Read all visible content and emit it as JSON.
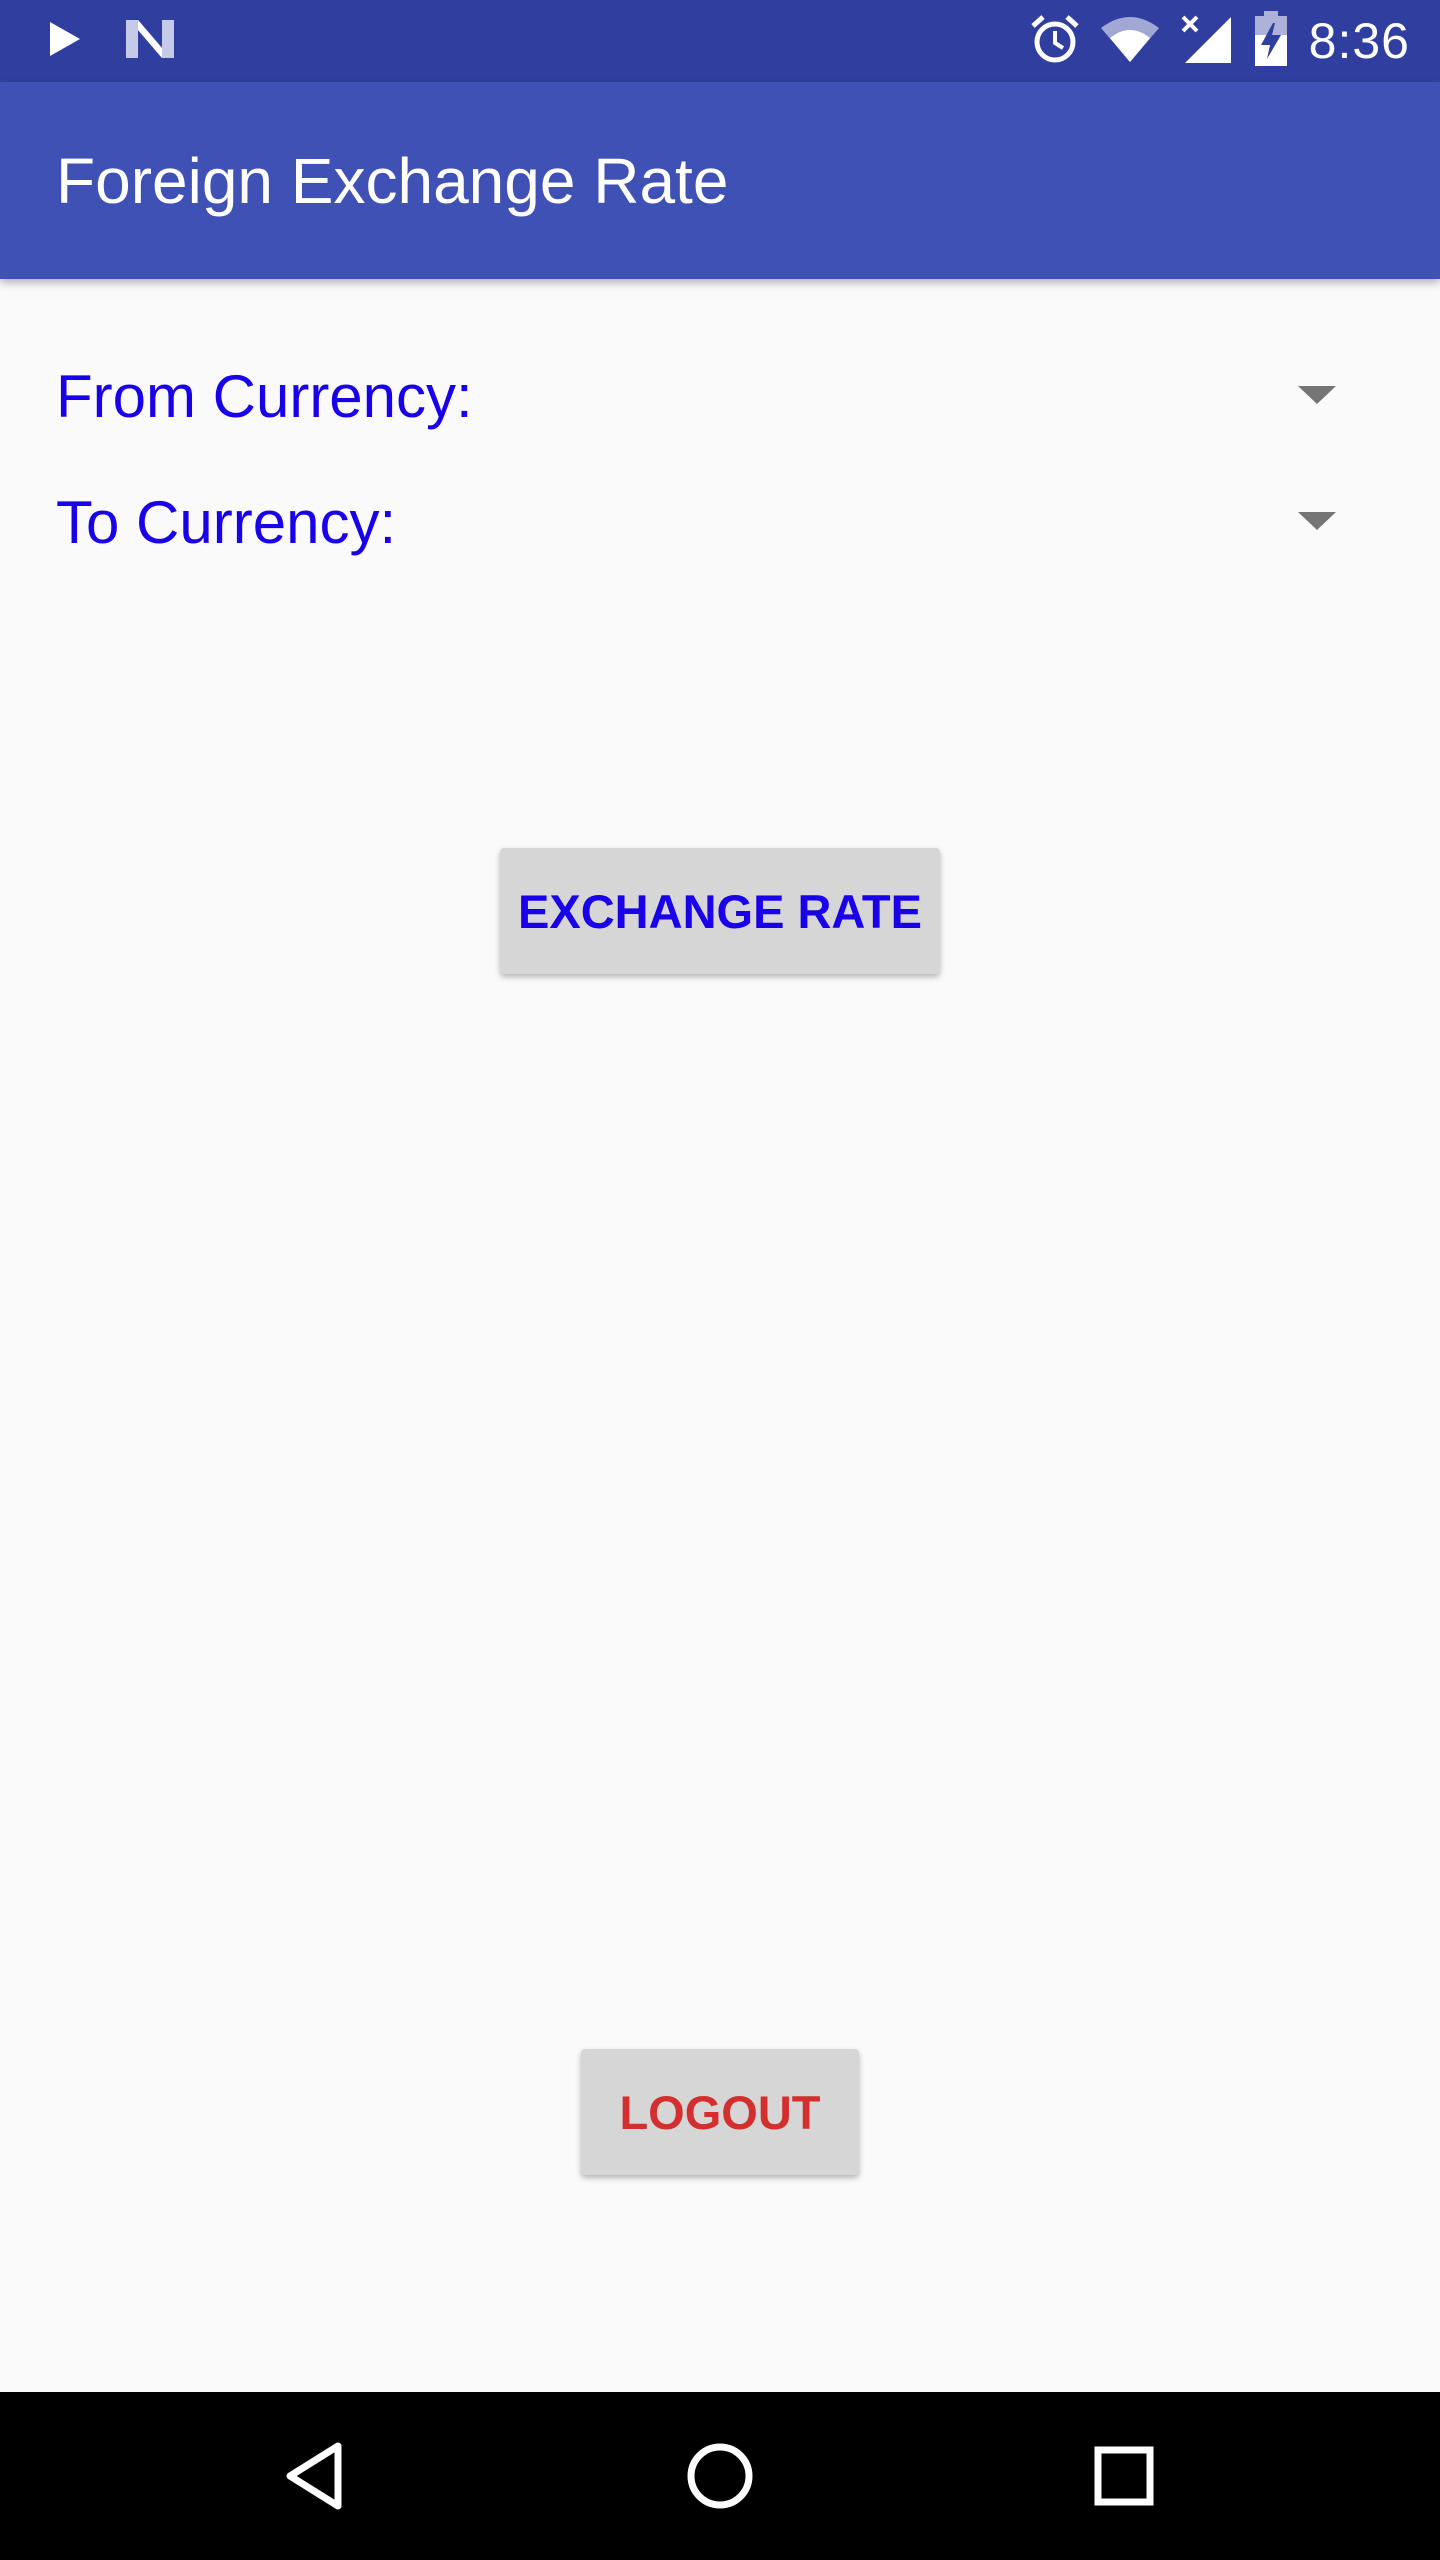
{
  "status_bar": {
    "time": "8:36",
    "icons": [
      "play-icon",
      "n-notification-icon",
      "alarm-icon",
      "wifi-icon",
      "signal-icon",
      "battery-charging-icon"
    ]
  },
  "app_bar": {
    "title": "Foreign Exchange Rate"
  },
  "form": {
    "from_label": "From Currency:",
    "to_label": "To Currency:"
  },
  "buttons": {
    "exchange_label": "EXCHANGE RATE",
    "logout_label": "LOGOUT"
  },
  "colors": {
    "status_bar": "#303f9f",
    "app_bar": "#3f51b5",
    "label_text": "#1a00e8",
    "logout_text": "#d32f2f",
    "button_bg": "#d6d6d6"
  },
  "nav_bar": {
    "icons": [
      "back-icon",
      "home-icon",
      "recents-icon"
    ]
  }
}
